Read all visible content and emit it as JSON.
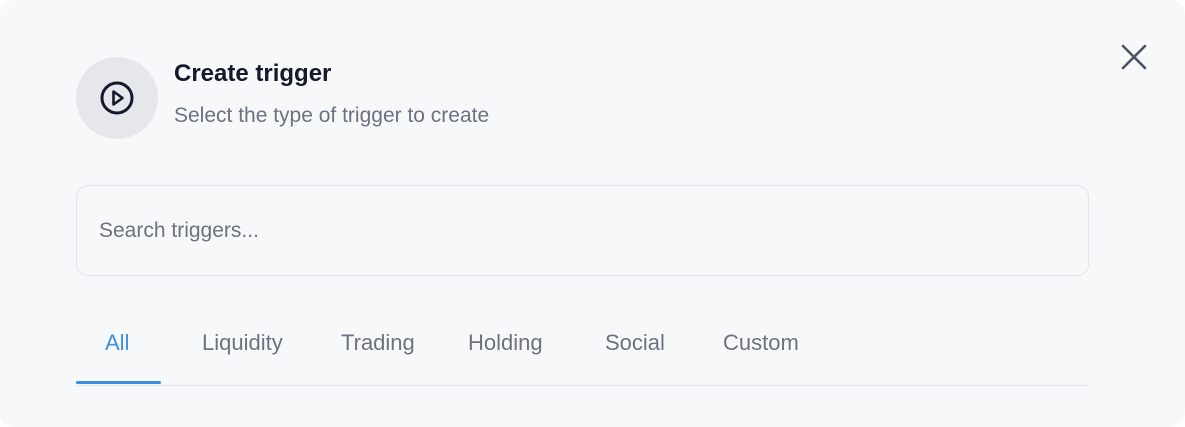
{
  "dialog": {
    "title": "Create trigger",
    "subtitle": "Select the type of trigger to create",
    "icon": "play-circle-icon",
    "close_icon": "close-icon"
  },
  "search": {
    "placeholder": "Search triggers...",
    "value": ""
  },
  "tabs": [
    {
      "label": "All",
      "active": true
    },
    {
      "label": "Liquidity",
      "active": false
    },
    {
      "label": "Trading",
      "active": false
    },
    {
      "label": "Holding",
      "active": false
    },
    {
      "label": "Social",
      "active": false
    },
    {
      "label": "Custom",
      "active": false
    }
  ],
  "colors": {
    "accent": "#3b8fe0",
    "background": "#f7f8fa",
    "title": "#141a2b",
    "muted": "#6b7280"
  }
}
